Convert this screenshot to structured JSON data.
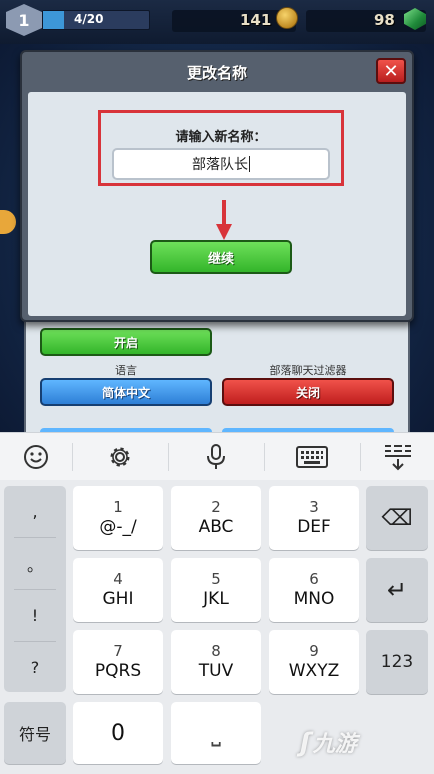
{
  "hud": {
    "level": "1",
    "xp": "4/20",
    "xp_progress": 0.2,
    "coins": "141",
    "gems": "98"
  },
  "dialog": {
    "title": "更改名称",
    "close_label": "✕",
    "prompt": "请输入新名称：",
    "input_value": "部落队长",
    "continue_label": "继续"
  },
  "settings": {
    "toggle_label": "开启",
    "language_label": "语言",
    "language_value": "简体中文",
    "filter_label": "部落聊天过滤器",
    "filter_value": "关闭"
  },
  "keyboard": {
    "left_keys": [
      ",",
      "。",
      "!",
      "?"
    ],
    "rows": [
      [
        {
          "num": "1",
          "letters": "@-_/"
        },
        {
          "num": "2",
          "letters": "ABC"
        },
        {
          "num": "3",
          "letters": "DEF"
        }
      ],
      [
        {
          "num": "4",
          "letters": "GHI"
        },
        {
          "num": "5",
          "letters": "JKL"
        },
        {
          "num": "6",
          "letters": "MNO"
        }
      ],
      [
        {
          "num": "7",
          "letters": "PQRS"
        },
        {
          "num": "8",
          "letters": "TUV"
        },
        {
          "num": "9",
          "letters": "WXYZ"
        }
      ]
    ],
    "symbols_label": "符号",
    "zero_label": "0",
    "space_glyph": "⎵",
    "mode_label": "123",
    "backspace_glyph": "⌫",
    "enter_glyph": "↵"
  },
  "watermark": "九游",
  "colors": {
    "highlight": "#d8343a",
    "primary_green": "#33b52a",
    "primary_blue": "#2e7fd6",
    "danger_red": "#c01e1e"
  }
}
